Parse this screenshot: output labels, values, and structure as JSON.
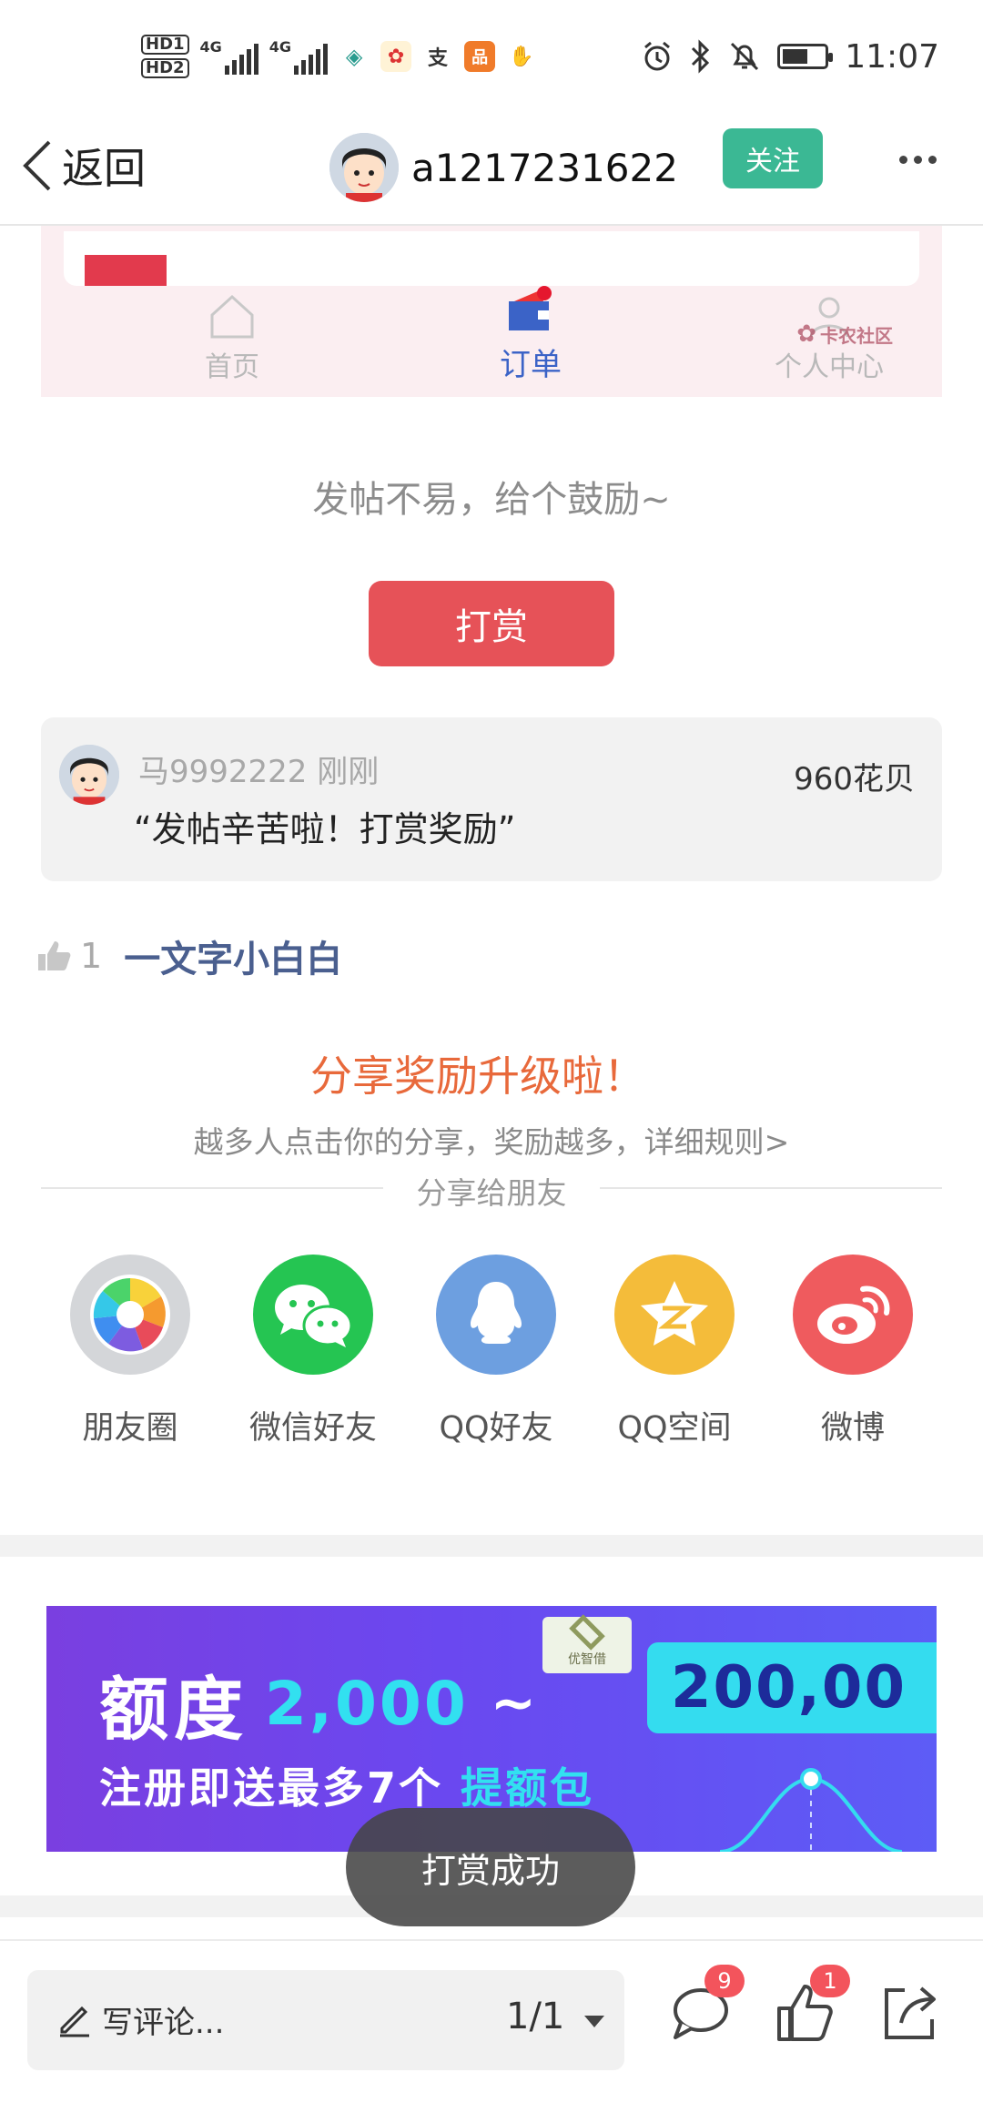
{
  "status_bar": {
    "hd1": "HD1",
    "hd2": "HD2",
    "network1": "4G",
    "network2": "4G",
    "time": "11:07",
    "battery_level": 0.6,
    "icons": [
      "alarm-icon",
      "bluetooth-icon",
      "mute-bell-icon",
      "battery-icon"
    ]
  },
  "nav": {
    "back_label": "返回",
    "username": "a1217231622",
    "follow_label": "关注"
  },
  "embedded_screenshot": {
    "tabs": [
      {
        "label": "首页",
        "icon": "home-icon"
      },
      {
        "label": "订单",
        "icon": "wallet-icon"
      },
      {
        "label": "个人中心",
        "icon": "person-icon"
      }
    ],
    "watermark": "卡农社区"
  },
  "encourage_text": "发帖不易，给个鼓励~",
  "reward_button": "打赏",
  "reward_record": {
    "user": "马9992222",
    "time": "刚刚",
    "message": "“发帖辛苦啦！打赏奖励”",
    "amount": "960花贝"
  },
  "likes": {
    "count": "1",
    "user": "一文字小白白"
  },
  "share": {
    "title": "分享奖励升级啦！",
    "subtitle": "越多人点击你的分享，奖励越多，详细规则>",
    "divider_text": "分享给朋友",
    "targets": [
      {
        "label": "朋友圈",
        "icon": "moments-icon",
        "color": "#d4d6d9"
      },
      {
        "label": "微信好友",
        "icon": "wechat-icon",
        "color": "#25c552"
      },
      {
        "label": "QQ好友",
        "icon": "qq-icon",
        "color": "#6d9fe0"
      },
      {
        "label": "QQ空间",
        "icon": "qzone-icon",
        "color": "#f4bc3a"
      },
      {
        "label": "微博",
        "icon": "weibo-icon",
        "color": "#ef5b5e"
      }
    ]
  },
  "ad": {
    "logo_text": "优智借",
    "line1_word": "额度",
    "line1_num": "2,000",
    "line1_tilde": "~",
    "line1_box": "200,00",
    "line2_main": "注册即送最多7个",
    "line2_highlight": "提额包"
  },
  "toast": "打赏成功",
  "bottom_bar": {
    "comment_placeholder": "写评论...",
    "pager": "1/1",
    "comment_badge": "9",
    "like_badge": "1"
  }
}
